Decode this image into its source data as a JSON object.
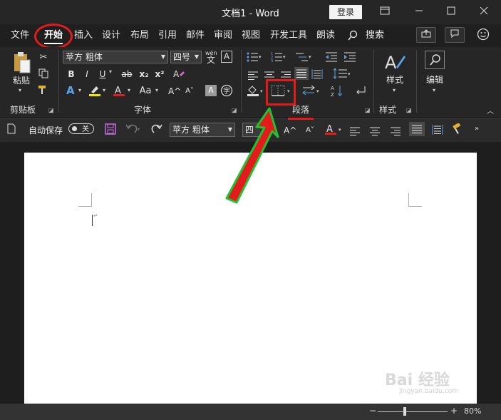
{
  "titlebar": {
    "title": "文档1  -  Word",
    "login_label": "登录",
    "window_controls": [
      "restore-ribbon-icon",
      "minimize-icon",
      "maximize-icon",
      "close-icon"
    ]
  },
  "tabs": [
    "文件",
    "开始",
    "插入",
    "设计",
    "布局",
    "引用",
    "邮件",
    "审阅",
    "视图",
    "开发工具",
    "朗读",
    "搜索"
  ],
  "active_tab": "开始",
  "ribbon": {
    "clipboard": {
      "paste_label": "粘贴",
      "group_label": "剪贴板"
    },
    "font": {
      "font_name": "苹方 粗体",
      "font_size": "四号",
      "wen_label": "wén",
      "a_box_label": "A",
      "bold": "B",
      "italic": "I",
      "underline": "U",
      "strike": "ab",
      "subscript": "x₂",
      "superscript": "x²",
      "grow_label": "A^",
      "shrink_label": "A˅",
      "aa_label": "Aa",
      "group_label": "字体"
    },
    "paragraph": {
      "group_label": "段落"
    },
    "styles": {
      "label": "样式",
      "group_label": "样式"
    },
    "editing": {
      "label": "编辑"
    }
  },
  "quickbar": {
    "autosave_label": "自动保存",
    "toggle_state": "关",
    "font_name": "苹方 粗体",
    "font_size": "四"
  },
  "status": {
    "zoom": "80%"
  },
  "watermark": {
    "text": "Bai 经验",
    "sub": "jingyan.baidu.com"
  },
  "colors": {
    "accent_red": "#e31b1b",
    "arrow_green": "#22c133",
    "highlight_yellow": "#f5e400"
  }
}
